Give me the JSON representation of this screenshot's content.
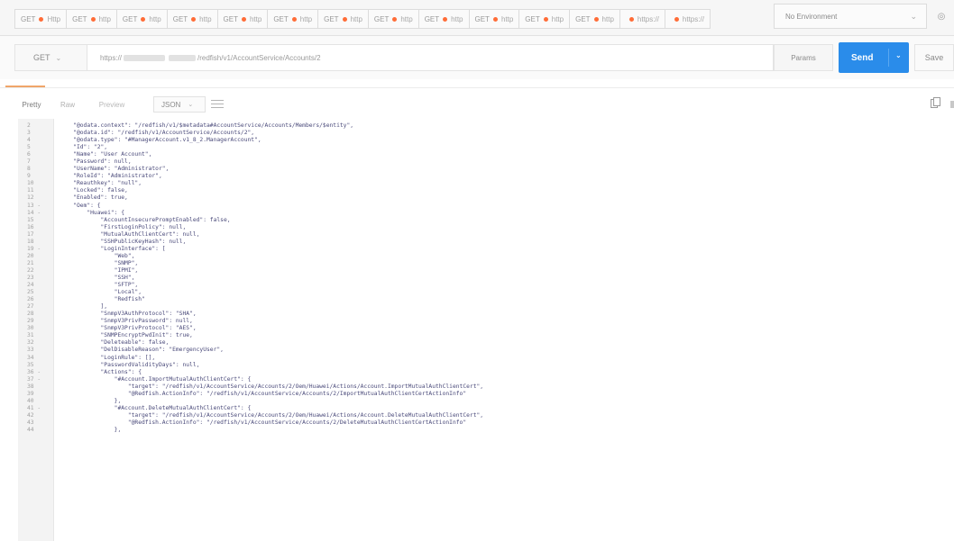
{
  "tabs": [
    {
      "method": "GET",
      "label": "Http"
    },
    {
      "method": "GET",
      "label": "http"
    },
    {
      "method": "GET",
      "label": "http"
    },
    {
      "method": "GET",
      "label": "http"
    },
    {
      "method": "GET",
      "label": "http"
    },
    {
      "method": "GET",
      "label": "http"
    },
    {
      "method": "GET",
      "label": "http"
    },
    {
      "method": "GET",
      "label": "http"
    },
    {
      "method": "GET",
      "label": "http"
    },
    {
      "method": "GET",
      "label": "http"
    },
    {
      "method": "GET",
      "label": "http"
    },
    {
      "method": "GET",
      "label": "http"
    },
    {
      "method": "",
      "label": "https://"
    },
    {
      "method": "",
      "label": "https://"
    }
  ],
  "tab_dot_color": "#ff6c37",
  "environment": {
    "label": "No Environment"
  },
  "request": {
    "method": "GET",
    "url_prefix": "https://",
    "url_suffix": "/redfish/v1/AccountService/Accounts/2",
    "params_label": "Params",
    "send_label": "Send",
    "save_label": "Save"
  },
  "accent_color": "#2a8cea",
  "response_toolbar": {
    "pretty": "Pretty",
    "raw": "Raw",
    "preview": "Preview",
    "format": "JSON"
  },
  "code_lines": [
    {
      "n": "2",
      "t": "    \"@odata.context\": \"/redfish/v1/$metadata#AccountService/Accounts/Members/$entity\","
    },
    {
      "n": "3",
      "t": "    \"@odata.id\": \"/redfish/v1/AccountService/Accounts/2\","
    },
    {
      "n": "4",
      "t": "    \"@odata.type\": \"#ManagerAccount.v1_8_2.ManagerAccount\","
    },
    {
      "n": "5",
      "t": "    \"Id\": \"2\","
    },
    {
      "n": "6",
      "t": "    \"Name\": \"User Account\","
    },
    {
      "n": "7",
      "t": "    \"Password\": null,"
    },
    {
      "n": "8",
      "t": "    \"UserName\": \"Administrator\","
    },
    {
      "n": "9",
      "t": "    \"RoleId\": \"Administrator\","
    },
    {
      "n": "10",
      "t": "    \"Reauthkey\": \"null\","
    },
    {
      "n": "11",
      "t": "    \"Locked\": false,"
    },
    {
      "n": "12",
      "t": "    \"Enabled\": true,"
    },
    {
      "n": "13 -",
      "t": "    \"Oem\": {"
    },
    {
      "n": "14 -",
      "t": "        \"Huawei\": {"
    },
    {
      "n": "15",
      "t": "            \"AccountInsecurePromptEnabled\": false,"
    },
    {
      "n": "16",
      "t": "            \"FirstLoginPolicy\": null,"
    },
    {
      "n": "17",
      "t": "            \"MutualAuthClientCert\": null,"
    },
    {
      "n": "18",
      "t": "            \"SSHPublicKeyHash\": null,"
    },
    {
      "n": "19 -",
      "t": "            \"LoginInterface\": ["
    },
    {
      "n": "20",
      "t": "                \"Web\","
    },
    {
      "n": "21",
      "t": "                \"SNMP\","
    },
    {
      "n": "22",
      "t": "                \"IPMI\","
    },
    {
      "n": "23",
      "t": "                \"SSH\","
    },
    {
      "n": "24",
      "t": "                \"SFTP\","
    },
    {
      "n": "25",
      "t": "                \"Local\","
    },
    {
      "n": "26",
      "t": "                \"Redfish\""
    },
    {
      "n": "27",
      "t": "            ],"
    },
    {
      "n": "28",
      "t": "            \"SnmpV3AuthProtocol\": \"SHA\","
    },
    {
      "n": "29",
      "t": "            \"SnmpV3PrivPassword\": null,"
    },
    {
      "n": "30",
      "t": "            \"SnmpV3PrivProtocol\": \"AES\","
    },
    {
      "n": "31",
      "t": "            \"SNMPEncryptPwdInit\": true,"
    },
    {
      "n": "32",
      "t": "            \"Deleteable\": false,"
    },
    {
      "n": "33",
      "t": "            \"DelDisableReason\": \"EmergencyUser\","
    },
    {
      "n": "34",
      "t": "            \"LoginRule\": [],"
    },
    {
      "n": "35",
      "t": "            \"PasswordValidityDays\": null,"
    },
    {
      "n": "36 -",
      "t": "            \"Actions\": {"
    },
    {
      "n": "37 -",
      "t": "                \"#Account.ImportMutualAuthClientCert\": {"
    },
    {
      "n": "38",
      "t": "                    \"target\": \"/redfish/v1/AccountService/Accounts/2/Oem/Huawei/Actions/Account.ImportMutualAuthClientCert\","
    },
    {
      "n": "39",
      "t": "                    \"@Redfish.ActionInfo\": \"/redfish/v1/AccountService/Accounts/2/ImportMutualAuthClientCertActionInfo\""
    },
    {
      "n": "40",
      "t": "                },"
    },
    {
      "n": "41 -",
      "t": "                \"#Account.DeleteMutualAuthClientCert\": {"
    },
    {
      "n": "42",
      "t": "                    \"target\": \"/redfish/v1/AccountService/Accounts/2/Oem/Huawei/Actions/Account.DeleteMutualAuthClientCert\","
    },
    {
      "n": "43",
      "t": "                    \"@Redfish.ActionInfo\": \"/redfish/v1/AccountService/Accounts/2/DeleteMutualAuthClientCertActionInfo\""
    },
    {
      "n": "44",
      "t": "                },"
    }
  ]
}
